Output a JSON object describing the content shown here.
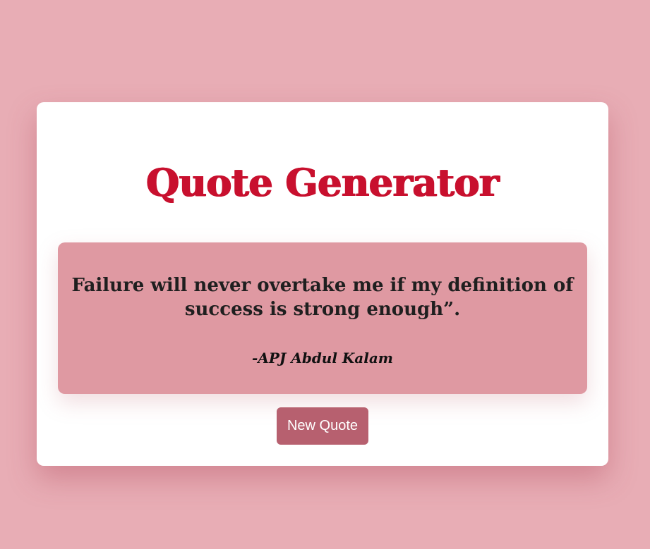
{
  "app": {
    "title": "Quote Generator"
  },
  "quote": {
    "text": "Failure will never overtake me if my definition of success is strong enough”.",
    "author": "-APJ Abdul Kalam"
  },
  "actions": {
    "new_quote_label": "New Quote"
  },
  "colors": {
    "background": "#e8adb5",
    "card": "#ffffff",
    "title": "#c8102e",
    "quote_box": "#df99a2",
    "button": "#b7606f",
    "button_text": "#ffffff"
  }
}
